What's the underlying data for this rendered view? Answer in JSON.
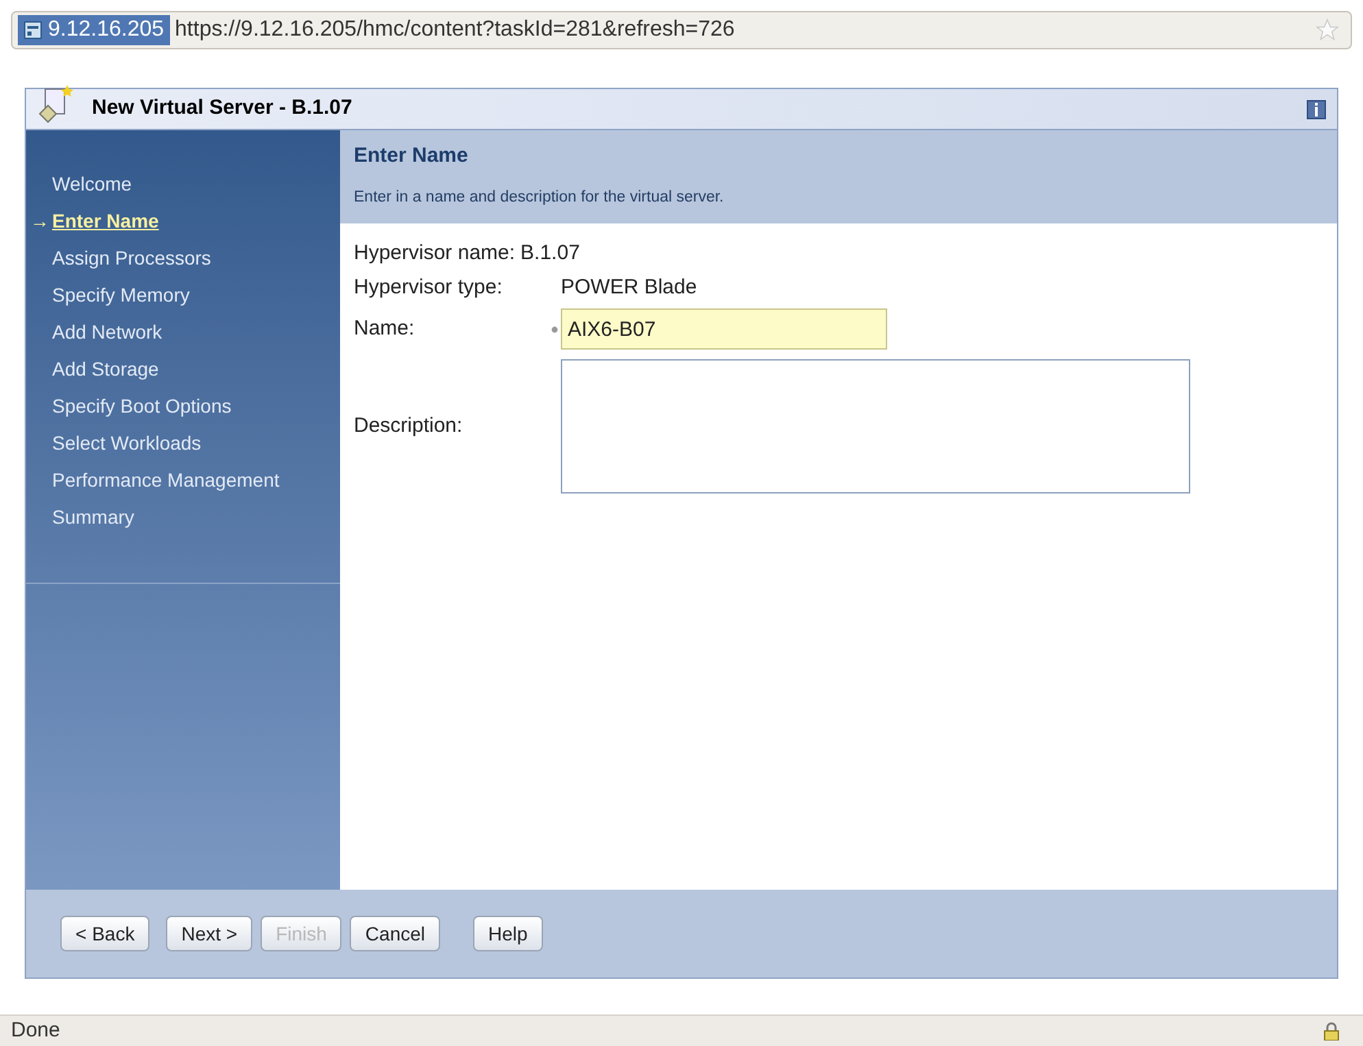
{
  "address_bar": {
    "site": "9.12.16.205",
    "url": "https://9.12.16.205/hmc/content?taskId=281&refresh=726"
  },
  "window": {
    "title": "New Virtual Server - B.1.07"
  },
  "steps": [
    {
      "label": "Welcome",
      "selected": false
    },
    {
      "label": "Enter Name",
      "selected": true
    },
    {
      "label": "Assign Processors",
      "selected": false
    },
    {
      "label": "Specify Memory",
      "selected": false
    },
    {
      "label": "Add Network",
      "selected": false
    },
    {
      "label": "Add Storage",
      "selected": false
    },
    {
      "label": "Specify Boot Options",
      "selected": false
    },
    {
      "label": "Select Workloads",
      "selected": false
    },
    {
      "label": "Performance Management",
      "selected": false
    },
    {
      "label": "Summary",
      "selected": false
    }
  ],
  "current_marker": "→",
  "page": {
    "title": "Enter Name",
    "subtitle": "Enter in a name and description for the virtual server."
  },
  "info": [
    {
      "label": "Hypervisor name:",
      "value": "B.1.07"
    },
    {
      "label": "Hypervisor type:",
      "value": "POWER Blade"
    }
  ],
  "form": {
    "name": {
      "label": "Name:",
      "required": true,
      "value": "AIX6-B07"
    },
    "description": {
      "label": "Description:"
    }
  },
  "buttons": [
    {
      "label": "< Back",
      "disabled": false
    },
    {
      "label": "Next >",
      "disabled": false
    },
    {
      "label": "Finish",
      "disabled": true
    },
    {
      "label": "Cancel",
      "disabled": false
    },
    {
      "label": "Help",
      "disabled": false
    }
  ],
  "status_bar": {
    "text": "Done"
  }
}
